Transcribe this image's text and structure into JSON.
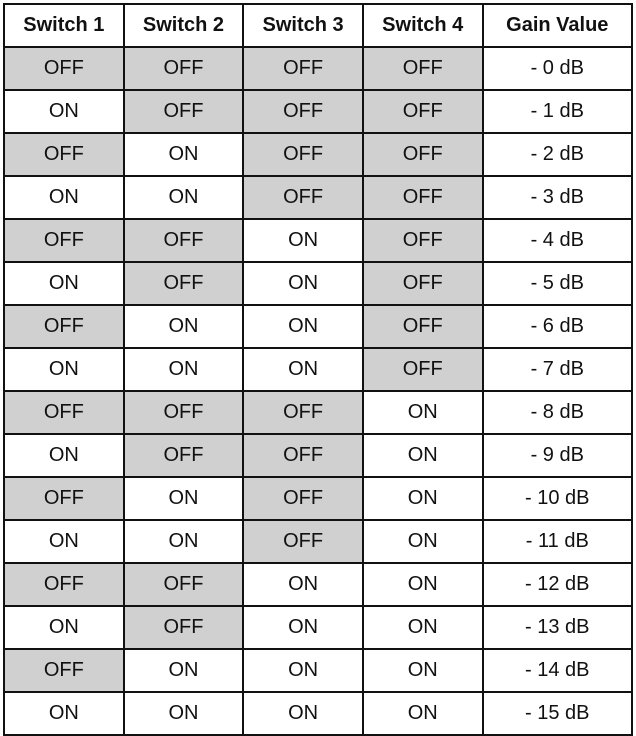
{
  "headers": [
    "Switch 1",
    "Switch 2",
    "Switch 3",
    "Switch 4",
    "Gain Value"
  ],
  "off_color": "#d0d0d0",
  "rows": [
    [
      "OFF",
      "OFF",
      "OFF",
      "OFF",
      "- 0 dB"
    ],
    [
      "ON",
      "OFF",
      "OFF",
      "OFF",
      "- 1 dB"
    ],
    [
      "OFF",
      "ON",
      "OFF",
      "OFF",
      "- 2 dB"
    ],
    [
      "ON",
      "ON",
      "OFF",
      "OFF",
      "- 3 dB"
    ],
    [
      "OFF",
      "OFF",
      "ON",
      "OFF",
      "- 4 dB"
    ],
    [
      "ON",
      "OFF",
      "ON",
      "OFF",
      "- 5 dB"
    ],
    [
      "OFF",
      "ON",
      "ON",
      "OFF",
      "- 6 dB"
    ],
    [
      "ON",
      "ON",
      "ON",
      "OFF",
      "- 7 dB"
    ],
    [
      "OFF",
      "OFF",
      "OFF",
      "ON",
      "- 8 dB"
    ],
    [
      "ON",
      "OFF",
      "OFF",
      "ON",
      "- 9 dB"
    ],
    [
      "OFF",
      "ON",
      "OFF",
      "ON",
      "- 10 dB"
    ],
    [
      "ON",
      "ON",
      "OFF",
      "ON",
      "- 11 dB"
    ],
    [
      "OFF",
      "OFF",
      "ON",
      "ON",
      "- 12 dB"
    ],
    [
      "ON",
      "OFF",
      "ON",
      "ON",
      "- 13 dB"
    ],
    [
      "OFF",
      "ON",
      "ON",
      "ON",
      "- 14 dB"
    ],
    [
      "ON",
      "ON",
      "ON",
      "ON",
      "- 15 dB"
    ]
  ]
}
